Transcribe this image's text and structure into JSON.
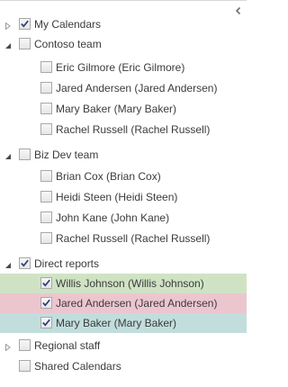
{
  "tree": {
    "my_calendars": {
      "label": "My Calendars",
      "checked": true
    },
    "contoso_team": {
      "label": "Contoso team",
      "items": [
        {
          "label": "Eric Gilmore (Eric Gilmore)"
        },
        {
          "label": "Jared Andersen (Jared Andersen)"
        },
        {
          "label": "Mary Baker (Mary Baker)"
        },
        {
          "label": "Rachel Russell (Rachel Russell)"
        }
      ]
    },
    "biz_dev_team": {
      "label": "Biz Dev team",
      "items": [
        {
          "label": "Brian Cox (Brian Cox)"
        },
        {
          "label": "Heidi Steen (Heidi Steen)"
        },
        {
          "label": "John Kane (John Kane)"
        },
        {
          "label": "Rachel Russell (Rachel Russell)"
        }
      ]
    },
    "direct_reports": {
      "label": "Direct reports",
      "checked": true,
      "items": [
        {
          "label": "Willis Johnson (Willis Johnson)",
          "checked": true,
          "color": "#cfe3c4"
        },
        {
          "label": "Jared Andersen (Jared Andersen)",
          "checked": true,
          "color": "#ecc6cf"
        },
        {
          "label": "Mary Baker (Mary Baker)",
          "checked": true,
          "color": "#c1dedd"
        }
      ]
    },
    "regional_staff": {
      "label": "Regional staff"
    },
    "shared_calendars": {
      "label": "Shared Calendars"
    }
  },
  "icons": {
    "collapse": "chevron-left-icon",
    "expanded": "expanded-triangle-icon",
    "collapsed": "collapsed-triangle-icon",
    "check": "check-icon"
  }
}
